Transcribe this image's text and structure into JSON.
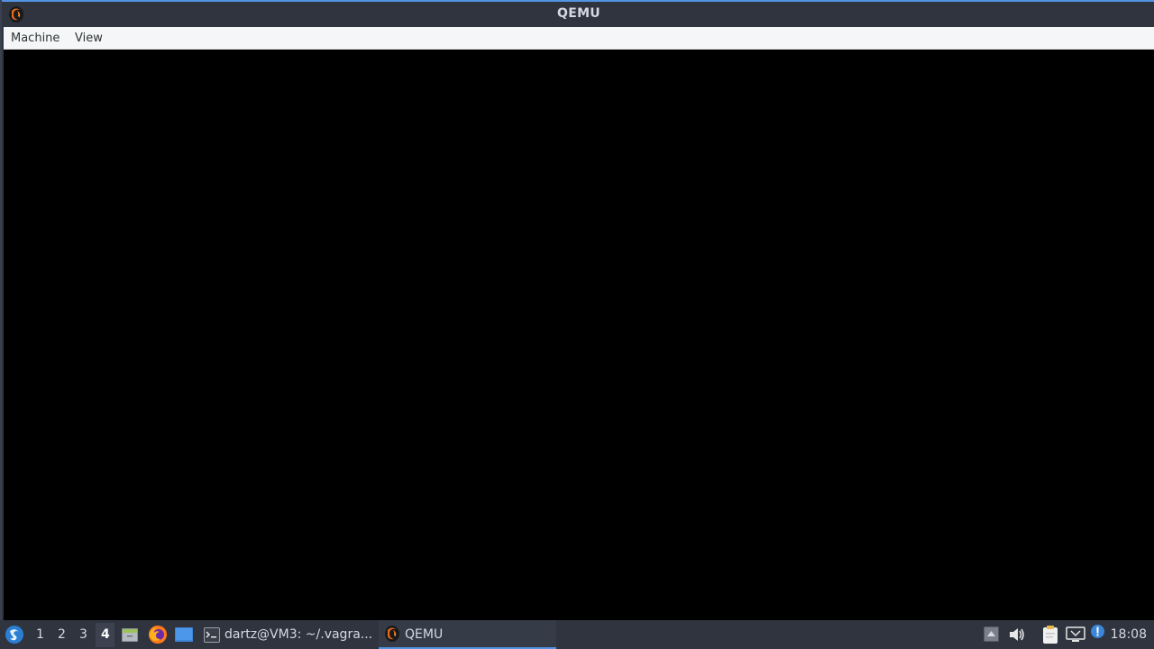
{
  "window": {
    "title": "QEMU",
    "icon": "qemu-icon"
  },
  "menubar": {
    "items": [
      {
        "label": "Machine"
      },
      {
        "label": "View"
      }
    ]
  },
  "taskbar": {
    "start_icon": "lxqt-start-icon",
    "workspaces": [
      "1",
      "2",
      "3",
      "4"
    ],
    "active_workspace": "4",
    "launchers": [
      "file-manager-icon",
      "firefox-icon",
      "show-desktop-icon"
    ],
    "tasks": [
      {
        "label": "dartz@VM3: ~/.vagra...",
        "icon": "terminal-icon",
        "active": false
      },
      {
        "label": "QEMU",
        "icon": "qemu-icon",
        "active": true
      }
    ],
    "tray": [
      "tray-arrow-icon",
      "volume-icon",
      "clipboard-icon",
      "network-icon",
      "notification-icon"
    ],
    "clock": "18:08"
  },
  "colors": {
    "titlebar": "#2f343f",
    "accent": "#5294e2",
    "menubar": "#f5f6f7",
    "display": "#000000",
    "taskbar": "#2f343f"
  }
}
